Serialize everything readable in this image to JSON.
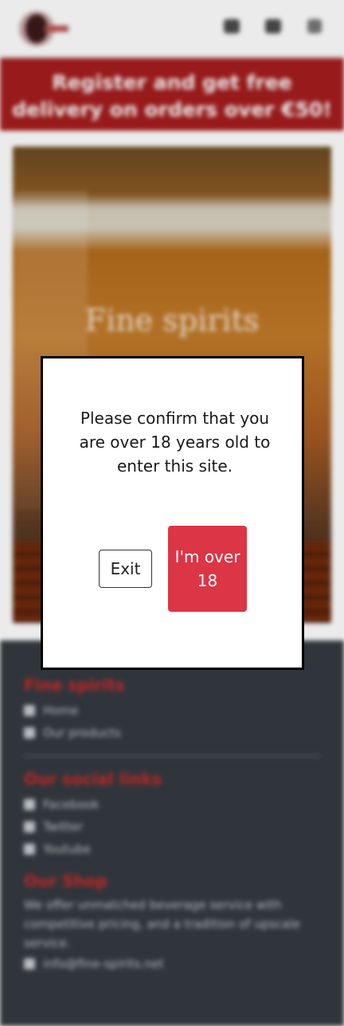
{
  "header": {
    "logo_name": "brand-logo",
    "icons": [
      "user-icon",
      "cart-icon",
      "menu-icon"
    ]
  },
  "promo": {
    "text": "Register and get free delivery on orders over €50!"
  },
  "hero": {
    "title": "Fine spirits"
  },
  "footer": {
    "site_heading": "Fine spirits",
    "site_links": [
      {
        "icon": "home-icon",
        "label": "Home"
      },
      {
        "icon": "pencil-icon",
        "label": "Our products"
      }
    ],
    "social_heading": "Our social links",
    "social_links": [
      {
        "icon": "facebook-icon",
        "label": "Facebook"
      },
      {
        "icon": "twitter-icon",
        "label": "Twitter"
      },
      {
        "icon": "youtube-icon",
        "label": "Youtube"
      }
    ],
    "shop_heading": "Our Shop",
    "shop_text": "We offer unmatched beverage service with competitive pricing, and a tradition of upscale service.",
    "email": "info@fine-spirits.net"
  },
  "modal": {
    "message": "Please confirm that you are over 18 years old to enter this site.",
    "exit_label": "Exit",
    "confirm_label": "I'm over 18"
  },
  "colors": {
    "promo_bg": "#a51d1d",
    "footer_bg": "#343a40",
    "footer_heading": "#d12a2a",
    "confirm_btn": "#dc3545"
  }
}
